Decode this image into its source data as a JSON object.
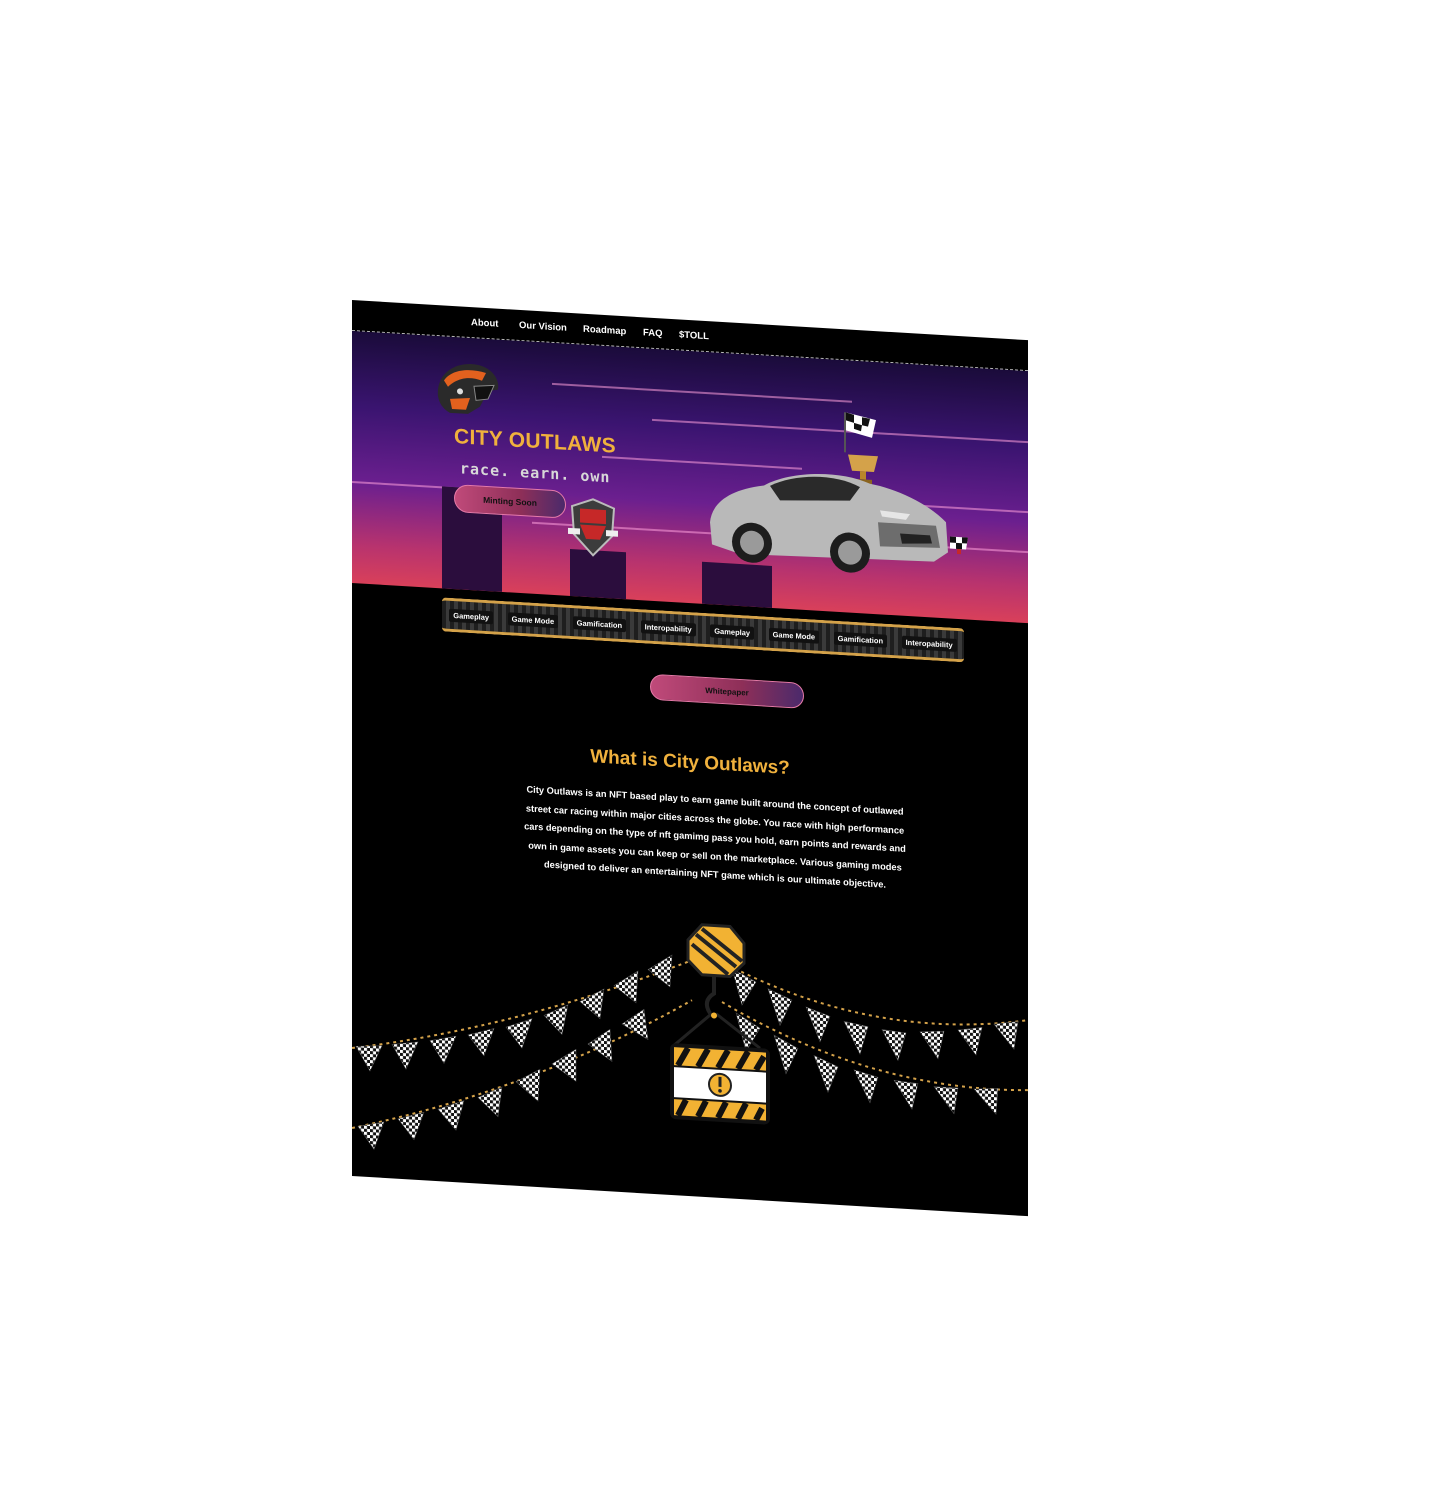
{
  "nav": {
    "items": [
      "About",
      "Our Vision",
      "Roadmap",
      "FAQ",
      "$TOLL"
    ]
  },
  "hero": {
    "title": "CITY OUTLAWS",
    "tagline": "race. earn. own",
    "cta_label": "Minting Soon"
  },
  "marquee": {
    "items": [
      "Gameplay",
      "Game Mode",
      "Gamification",
      "Interopability",
      "Gameplay",
      "Game Mode",
      "Gamification",
      "Interopability"
    ]
  },
  "whitepaper": {
    "label": "Whitepaper"
  },
  "about": {
    "title": "What is City Outlaws?",
    "body": "City Outlaws is an NFT based play to earn game built around the concept of outlawed street car racing within major cities across the globe. You race with high performance cars depending on the type of nft gamimg pass you hold, earn points and rewards and own in game assets you can keep or sell on the marketplace. Various gaming modes designed to deliver an entertaining NFT game which is our ultimate objective."
  },
  "colors": {
    "accent": "#f0b13d",
    "pill_gradient_start": "#c04a7a",
    "hero_top": "#1a0b3a",
    "hero_bottom": "#d9405a"
  },
  "icons": [
    "helmet-icon",
    "shield-badge-icon",
    "race-car-image",
    "trophy-icon",
    "checkered-flag-icon",
    "warning-sign-icon",
    "bunting-flags"
  ]
}
